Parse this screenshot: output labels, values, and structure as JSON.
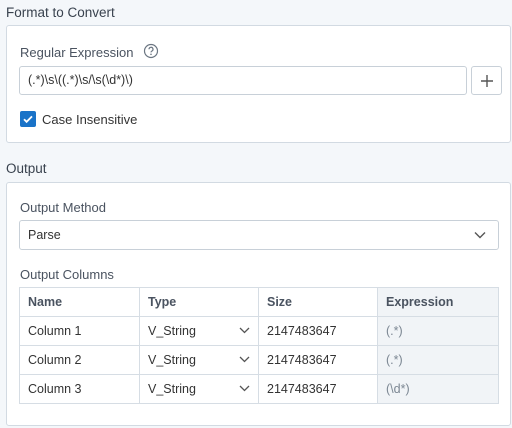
{
  "format_section": {
    "title": "Format to Convert",
    "regex_label": "Regular Expression",
    "regex_value": "(.*)\\s\\((.*)\\s/\\s(\\d*)\\)",
    "case_insensitive_label": "Case Insensitive",
    "case_insensitive_checked": true
  },
  "output_section": {
    "title": "Output",
    "method_label": "Output Method",
    "method_value": "Parse",
    "columns_label": "Output Columns",
    "headers": [
      "Name",
      "Type",
      "Size",
      "Expression"
    ],
    "rows": [
      {
        "name": "Column 1",
        "type": "V_String",
        "size": "2147483647",
        "expression": "(.*)"
      },
      {
        "name": "Column 2",
        "type": "V_String",
        "size": "2147483647",
        "expression": "(.*)"
      },
      {
        "name": "Column 3",
        "type": "V_String",
        "size": "2147483647",
        "expression": "(\\d*)"
      }
    ]
  },
  "colors": {
    "accent": "#1a73c8",
    "panel_border": "#d2dae2",
    "background": "#f4f7fa"
  },
  "icons": [
    "help-icon",
    "plus-icon",
    "check-icon",
    "chevron-down-icon"
  ]
}
